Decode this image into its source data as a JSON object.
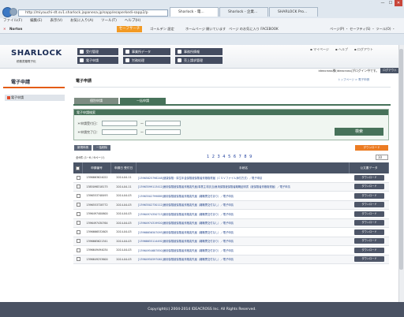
{
  "browser": {
    "url": "http://miyauchi-dt.sv1.sharlock.japanesa.jp/sapp/esaperkedi-sapp2/p",
    "tabs": [
      "Sharlock - 電...",
      "Sharlock - 企業...",
      "SHARLOCK Pro..."
    ],
    "menu": [
      "ファイル(F)",
      "編集(E)",
      "表示(V)",
      "お気に入り(A)",
      "ツール(T)",
      "ヘルプ(H)"
    ],
    "fav": {
      "norton": "Norton",
      "secure": "セーフサーチ",
      "f1": "ゴールデン 設定",
      "f2": "ホームページ 開いています",
      "f3": "ページ のお気に入り FACEBOOK",
      "right": "ページ(P) ・ セーフティ(S) ・ ツール(O) ・"
    },
    "win": [
      "—",
      "☐",
      "✕"
    ]
  },
  "site": {
    "logo": "SHARLOCK",
    "logo_sub": "税務書類電子化",
    "nav": [
      "受付管理",
      "事業所データ",
      "事務所情報",
      "電子申請",
      "労務処理",
      "売上請求管理"
    ],
    "util": [
      "▪ マイページ",
      "▪ ヘルプ",
      "▪ ログアウト"
    ],
    "user_line": "ideacross様(ideacross)がログイン中です。",
    "logout": "ログアウト"
  },
  "sidebar": {
    "title": "電子申請",
    "item": "電子申請"
  },
  "main": {
    "title": "電子申請",
    "breadcrumb": "トップページ > 電子申請",
    "tabs": [
      "個別申請",
      "一括申請"
    ],
    "search_header": "電子申請検索",
    "label_date1": "＊申請受付日：",
    "label_date2": "＊申請完了日：",
    "tilde": "〜",
    "search_btn": "検索",
    "btn1": "新規申請",
    "btn2": "一括削除",
    "download_all": "ダウンロード",
    "count": "全6件 (1~6 / 6ページ)",
    "pager": "1 2 3 4 5 6 7 8 9",
    "perpage": "10",
    "headers": [
      "",
      "申請番号",
      "申請日 受付日",
      "手続名",
      "公文書データ"
    ],
    "dl_label": "ダウンロード",
    "rows": [
      {
        "no": "1396663624022",
        "date": "2014-04-11",
        "name": "[13965825798248]健康保険・厚生年金保険被保険者資格取得届（ＣＳＶファイル添付方式）／電子申請"
      },
      {
        "no": "1385098318175",
        "date": "2014-04-11",
        "name": "[13963599113412]雇用保険被保険者資格喪失届(事業主非該当)雇用保険被保険者離職証明書（被保険者資格取得届）／電子申請"
      },
      {
        "no": "1396553748493",
        "date": "2014-04-03",
        "name": "[13963502799889]雇用保険被保険者資格喪失届（離職票交付あり）／電子申請"
      },
      {
        "no": "1396553728772",
        "date": "2014-04-03",
        "name": "[13963502730112]雇用保険被保険者資格喪失届（離職票交付なし）／電子申請"
      },
      {
        "no": "1396497400600",
        "date": "2014-04-03",
        "name": "[13964974350713]雇用保険被保険者資格喪失届（離職票交付あり）／電子申請"
      },
      {
        "no": "1396497430764",
        "date": "2014-04-03",
        "name": "[13964974319920]雇用保険被保険者資格喪失届（離職票交付なし）／電子申請"
      },
      {
        "no": "1396666532605",
        "date": "2014-04-03",
        "name": "[13966656507093]雇用保険被保険者資格喪失届（離職票交付なし）／電子申請"
      },
      {
        "no": "1396665621341",
        "date": "2014-04-03",
        "name": "[13966655114492]雇用保険被保険者資格喪失届（離職票交付あり）／電子申請"
      },
      {
        "no": "1396649494034",
        "date": "2014-04-03",
        "name": "[13964954687850]雇用保険被保険者資格喪失届（離職票交付あり）／電子申請"
      },
      {
        "no": "1396649253600",
        "date": "2014-04-03",
        "name": "[13964950597061]雇用保険被保険者資格喪失届（離職票交付なし）／電子申請"
      }
    ]
  },
  "footer": "Copyright(c) 2004-2014 IDEACROSS Inc. All Rights Reserved."
}
